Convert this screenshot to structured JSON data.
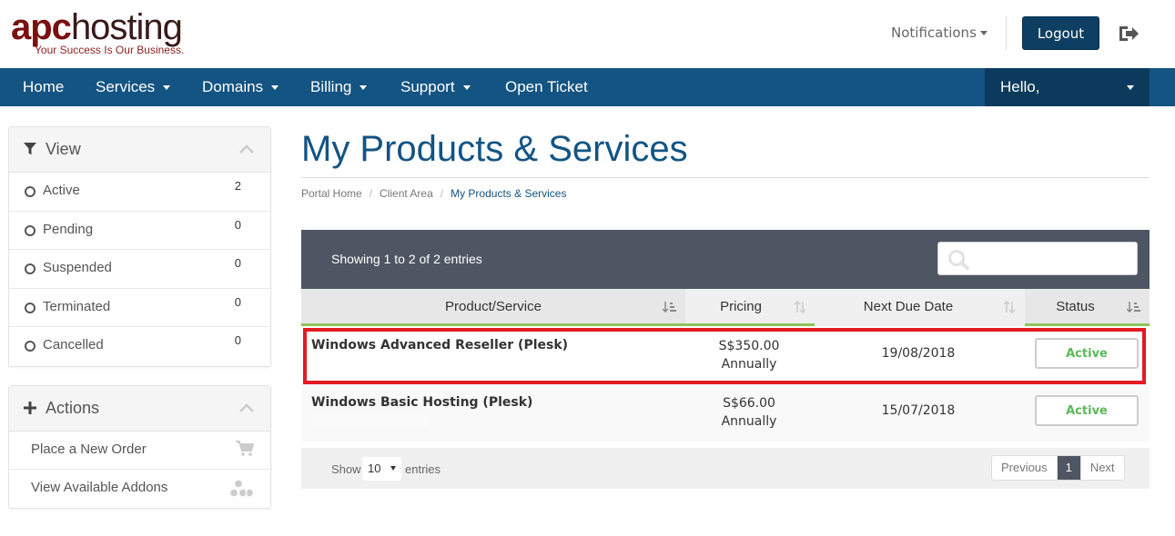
{
  "brand": {
    "logo_apc": "apc",
    "logo_hosting": "hosting",
    "tagline": "Your Success Is Our Business."
  },
  "header": {
    "notifications": "Notifications",
    "logout": "Logout"
  },
  "nav": {
    "items": [
      {
        "label": "Home"
      },
      {
        "label": "Services"
      },
      {
        "label": "Domains"
      },
      {
        "label": "Billing"
      },
      {
        "label": "Support"
      },
      {
        "label": "Open Ticket"
      }
    ],
    "user": "Hello,"
  },
  "sidebar": {
    "view_title": "View",
    "filters": [
      {
        "label": "Active",
        "count": "2"
      },
      {
        "label": "Pending",
        "count": "0"
      },
      {
        "label": "Suspended",
        "count": "0"
      },
      {
        "label": "Terminated",
        "count": "0"
      },
      {
        "label": "Cancelled",
        "count": "0"
      }
    ],
    "actions_title": "Actions",
    "actions": [
      {
        "label": "Place a New Order"
      },
      {
        "label": "View Available Addons"
      }
    ]
  },
  "page": {
    "title": "My Products & Services",
    "breadcrumb": [
      "Portal Home",
      "Client Area",
      "My Products & Services"
    ]
  },
  "table": {
    "showing": "Showing 1 to 2 of 2 entries",
    "search_placeholder": "",
    "columns": [
      "Product/Service",
      "Pricing",
      "Next Due Date",
      "Status"
    ],
    "rows": [
      {
        "name": "Windows Advanced Reseller (Plesk)",
        "price": "S$350.00",
        "cycle": "Annually",
        "due": "19/08/2018",
        "status": "Active"
      },
      {
        "name": "Windows Basic Hosting (Plesk)",
        "price": "S$66.00",
        "cycle": "Annually",
        "due": "15/07/2018",
        "status": "Active"
      }
    ],
    "footer": {
      "show": "Show",
      "per_page": "10",
      "entries": "entries",
      "previous": "Previous",
      "page": "1",
      "next": "Next"
    }
  },
  "colors": {
    "nav_bg": "#135483",
    "nav_user_bg": "#0c3a5c",
    "accent_green": "#8ec35a",
    "highlight": "#e21b23",
    "status_green": "#5cb85c"
  }
}
